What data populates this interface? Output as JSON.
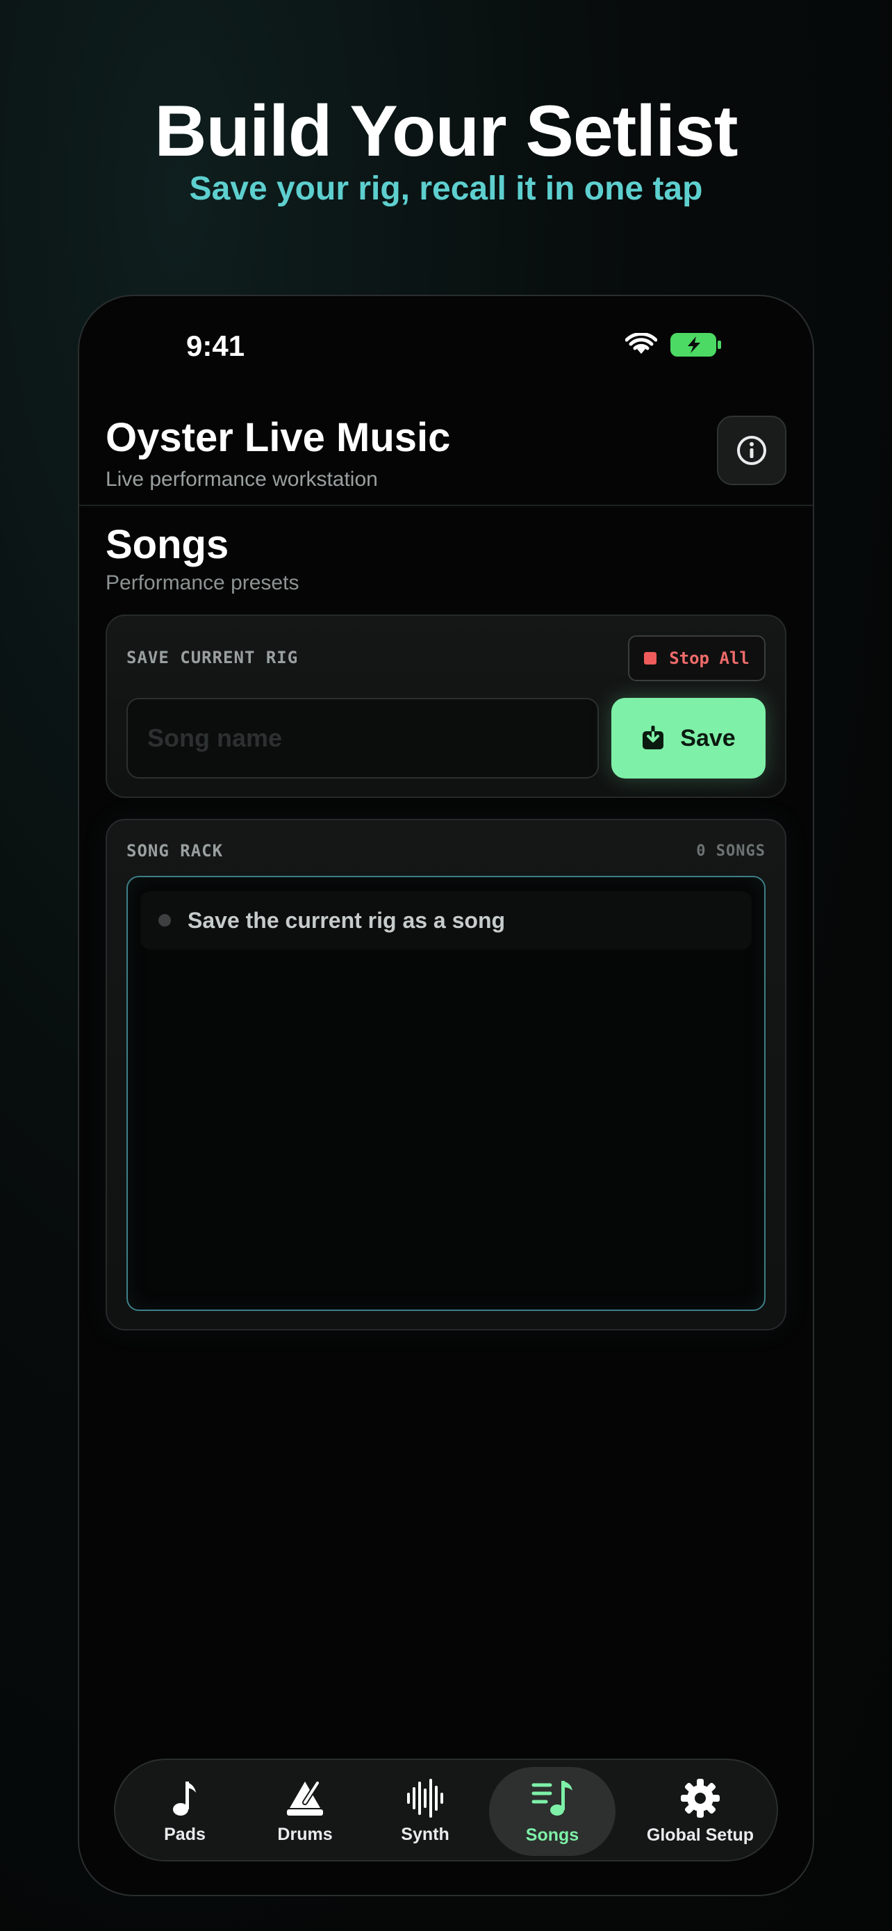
{
  "hero": {
    "title": "Build Your Setlist",
    "subtitle": "Save your rig, recall it in one tap"
  },
  "status_bar": {
    "time": "9:41",
    "icons": [
      "wifi-icon",
      "battery-charging-icon"
    ]
  },
  "app": {
    "title": "Oyster Live Music",
    "subtitle": "Live performance workstation",
    "info_icon": "info-icon"
  },
  "section": {
    "title": "Songs",
    "subtitle": "Performance presets"
  },
  "save_card": {
    "label": "SAVE CURRENT RIG",
    "stop_all_label": "Stop All",
    "song_name_placeholder": "Song name",
    "song_name_value": "",
    "save_label": "Save"
  },
  "rack": {
    "label": "SONG RACK",
    "count_label": "0 SONGS",
    "empty_text": "Save the current rig as a song"
  },
  "tabs": [
    {
      "label": "Pads",
      "icon": "music-note-icon",
      "active": false
    },
    {
      "label": "Drums",
      "icon": "metronome-icon",
      "active": false
    },
    {
      "label": "Synth",
      "icon": "waveform-icon",
      "active": false
    },
    {
      "label": "Songs",
      "icon": "music-list-icon",
      "active": true
    },
    {
      "label": "Global Setup",
      "icon": "gear-icon",
      "active": false
    }
  ],
  "colors": {
    "accent_green": "#7ef0a8",
    "accent_cyan": "#5ecfcf",
    "stop_red": "#ef5b5b",
    "rack_border": "#3e7f87"
  }
}
